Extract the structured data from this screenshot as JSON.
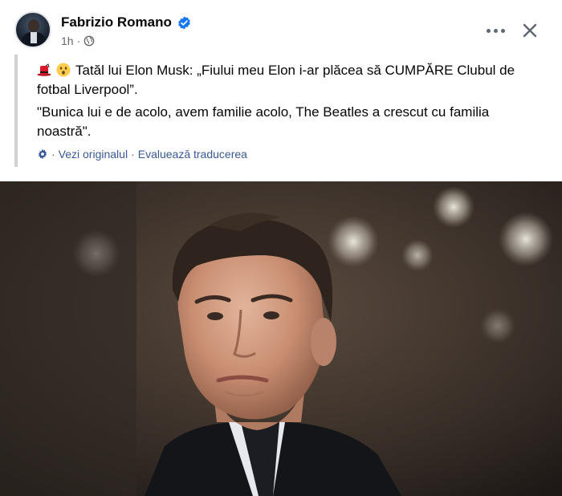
{
  "post": {
    "author": "Fabrizio Romano",
    "time": "1h",
    "separator": "·",
    "text_line1": "Tatăl lui Elon Musk: „Fiului meu Elon i-ar plăcea să CUMPĂRE Clubul de fotbal Liverpool”.",
    "text_line2": "\"Bunica lui e de acolo, avem familie acolo, The Beatles a crescut cu familia noastră\".",
    "see_original": "Vezi originalul",
    "rate_translation": "Evaluează traducerea",
    "dot": "·"
  },
  "colors": {
    "verified_blue": "#1877f2",
    "link_blue": "#385898",
    "meta_gray": "#65676b",
    "quote_bar": "#ced0d4"
  },
  "icons": {
    "verified": "verified-badge-icon",
    "globe": "globe-icon",
    "more": "more-options-icon",
    "close": "close-icon",
    "gear": "gear-icon",
    "hat": "red-hat-emoji",
    "face": "astonished-face-emoji"
  }
}
